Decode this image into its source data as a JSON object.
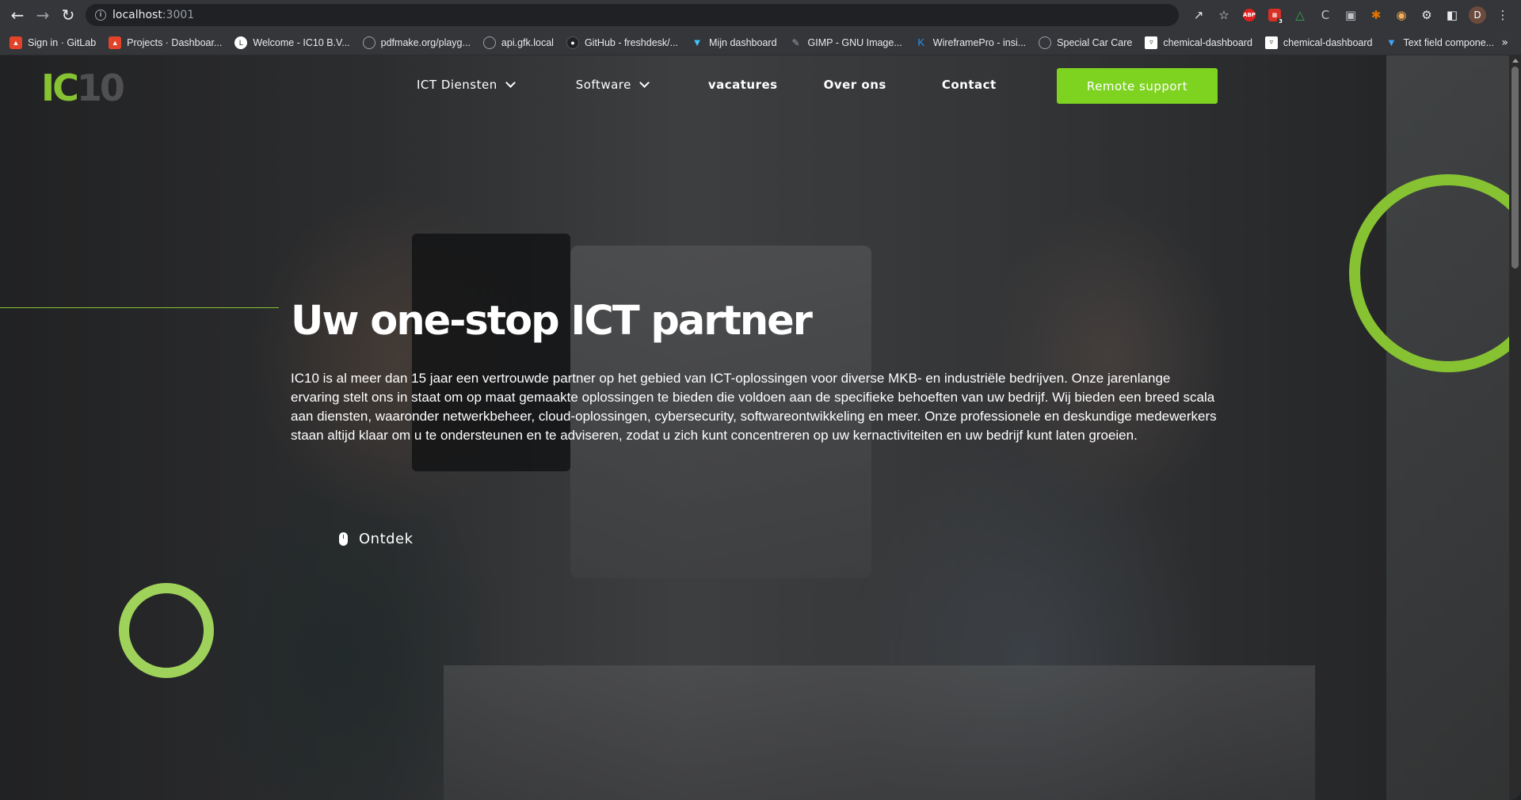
{
  "browser": {
    "url_host": "localhost",
    "url_port": ":3001",
    "profile_initial": "D",
    "extension_badge": "3",
    "bookmarks": [
      {
        "label": "Sign in · GitLab",
        "color": "#e24329"
      },
      {
        "label": "Projects · Dashboar...",
        "color": "#e24329"
      },
      {
        "label": "Welcome - IC10 B.V...",
        "color": "#ffffff"
      },
      {
        "label": "pdfmake.org/playg...",
        "color": "#9aa0a6"
      },
      {
        "label": "api.gfk.local",
        "color": "#9aa0a6"
      },
      {
        "label": "GitHub - freshdesk/...",
        "color": "#202124"
      },
      {
        "label": "Mijn dashboard",
        "color": "#40c4ff"
      },
      {
        "label": "GIMP - GNU Image...",
        "color": "#9aa0a6"
      },
      {
        "label": "WireframePro - insi...",
        "color": "#2196f3"
      },
      {
        "label": "Special Car Care",
        "color": "#9aa0a6"
      },
      {
        "label": "chemical-dashboard",
        "color": "#ffffff"
      },
      {
        "label": "chemical-dashboard",
        "color": "#ffffff"
      },
      {
        "label": "Text field compone...",
        "color": "#42a5f5"
      }
    ]
  },
  "site": {
    "logo_primary": "IC",
    "logo_secondary": "10",
    "accent_color": "#86c232",
    "nav": {
      "ict_diensten": "ICT Diensten",
      "software": "Software",
      "vacatures": "vacatures",
      "over_ons": "Over ons",
      "contact": "Contact"
    },
    "remote_support": "Remote support"
  },
  "hero": {
    "title": "Uw one-stop ICT partner",
    "text": "IC10 is al meer dan 15 jaar een vertrouwde partner op het gebied van ICT-oplossingen voor diverse MKB- en industriële bedrijven. Onze jarenlange ervaring stelt ons in staat om op maat gemaakte oplossingen te bieden die voldoen aan de specifieke behoeften van uw bedrijf. Wij bieden een breed scala aan diensten, waaronder netwerkbeheer, cloud-oplossingen, cybersecurity, softwareontwikkeling en meer. Onze professionele en deskundige medewerkers staan altijd klaar om u te ondersteunen en te adviseren, zodat u zich kunt concentreren op uw kernactiviteiten en uw bedrijf kunt laten groeien.",
    "discover": "Ontdek"
  }
}
